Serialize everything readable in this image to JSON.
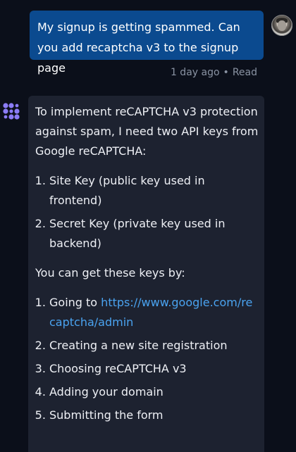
{
  "user_message": {
    "text": "My signup is getting spammed. Can you add recaptcha v3 to the signup page",
    "time": "1 day ago",
    "separator": "•",
    "status": "Read"
  },
  "assistant_message": {
    "intro": "To implement reCAPTCHA v3 protection against spam, I need two API keys from Google reCAPTCHA:",
    "keys": [
      "Site Key (public key used in frontend)",
      "Secret Key (private key used in backend)"
    ],
    "steps_intro": "You can get these keys by:",
    "step1_prefix": "Going to ",
    "step1_link": "https://www.google.com/recaptcha/admin",
    "steps": [
      "Creating a new site registration",
      "Choosing reCAPTCHA v3",
      "Adding your domain",
      "Submitting the form"
    ]
  },
  "colors": {
    "background": "#0b0f1a",
    "user_bubble": "#0b4a8f",
    "assistant_bubble": "#1d2230",
    "link": "#4aa3f0",
    "logo": "#8b7cf6"
  },
  "icons": {
    "assistant": "assistant-logo-icon",
    "user": "user-avatar"
  }
}
